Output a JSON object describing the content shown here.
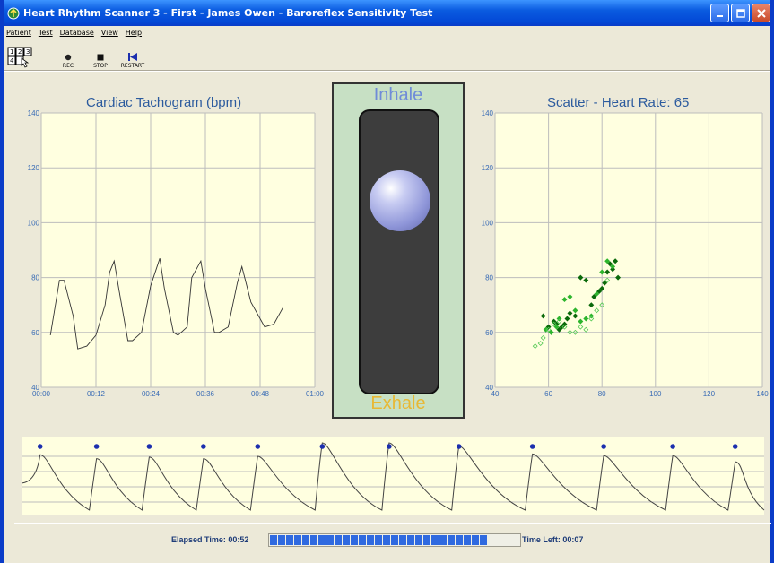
{
  "window": {
    "title": "Heart Rhythm Scanner 3 - First - James Owen - Baroreflex Sensitivity Test"
  },
  "menu": {
    "items": [
      "Patient",
      "Test",
      "Database",
      "View",
      "Help"
    ]
  },
  "toolbar": {
    "rec_label": "REC",
    "stop_label": "STOP",
    "restart_label": "RESTART"
  },
  "breathing": {
    "inhale": "Inhale",
    "exhale": "Exhale",
    "inhale_color": "#6F8BD8",
    "exhale_color": "#E8B834",
    "ball_level": 0.27
  },
  "status": {
    "elapsed": "Elapsed Time: 00:52",
    "left": "Time Left: 00:07",
    "progress_fraction": 0.88,
    "segment_color": "#2F6AE0"
  },
  "chart_data": [
    {
      "type": "line",
      "title": "Cardiac Tachogram (bpm)",
      "xlabel": "",
      "ylabel": "",
      "xlim": [
        0,
        60
      ],
      "ylim": [
        40,
        140
      ],
      "x_ticks": [
        "00:00",
        "00:12",
        "00:24",
        "00:36",
        "00:48",
        "01:00"
      ],
      "y_ticks": [
        "40",
        "60",
        "80",
        "100",
        "120",
        "140"
      ],
      "grid": true,
      "series": [
        {
          "color": "#333333",
          "x": [
            2,
            4,
            5,
            7,
            8,
            10,
            12,
            14,
            15,
            16,
            17,
            19,
            20,
            22,
            24,
            26,
            27,
            29,
            30,
            32,
            33,
            35,
            36,
            38,
            39,
            41,
            43,
            44,
            46,
            48,
            49,
            51,
            53
          ],
          "y": [
            59,
            79,
            79,
            66,
            54,
            55,
            59,
            70,
            82,
            86,
            76,
            57,
            57,
            60,
            77,
            87,
            76,
            60,
            59,
            62,
            80,
            86,
            76,
            60,
            60,
            62,
            78,
            84,
            71,
            65,
            62,
            63,
            69
          ]
        }
      ]
    },
    {
      "type": "scatter",
      "title": "Scatter - Heart Rate: 65",
      "xlim": [
        40,
        140
      ],
      "ylim": [
        40,
        140
      ],
      "x_ticks": [
        "40",
        "60",
        "80",
        "100",
        "120",
        "140"
      ],
      "y_ticks": [
        "40",
        "60",
        "80",
        "100",
        "120",
        "140"
      ],
      "grid": true,
      "series": [
        {
          "color": "#0B6A0B",
          "style": "filled",
          "x": [
            58,
            60,
            61,
            62,
            63,
            64,
            65,
            66,
            67,
            68,
            70,
            72,
            74,
            76,
            77,
            79,
            80,
            81,
            82,
            83,
            84,
            85,
            86
          ],
          "y": [
            66,
            62,
            60,
            64,
            63,
            61,
            62,
            63,
            65,
            67,
            66,
            80,
            79,
            70,
            73,
            75,
            76,
            78,
            82,
            85,
            83,
            86,
            80
          ]
        },
        {
          "color": "#2DB52D",
          "style": "filled",
          "x": [
            59,
            61,
            63,
            64,
            66,
            68,
            70,
            72,
            74,
            76,
            78,
            80,
            82,
            84
          ],
          "y": [
            61,
            60,
            62,
            65,
            72,
            73,
            68,
            64,
            65,
            66,
            74,
            82,
            86,
            84
          ]
        },
        {
          "color": "#55C955",
          "style": "hollow",
          "x": [
            55,
            57,
            58,
            60,
            62,
            64,
            66,
            68,
            70,
            72,
            74,
            76,
            78,
            80,
            82
          ],
          "y": [
            55,
            56,
            58,
            61,
            63,
            64,
            62,
            60,
            60,
            62,
            61,
            65,
            68,
            70,
            79
          ]
        }
      ]
    },
    {
      "type": "line",
      "title": "",
      "series": [
        {
          "color": "#444444",
          "beats": [
            0.025,
            0.101,
            0.172,
            0.245,
            0.318,
            0.405,
            0.495,
            0.589,
            0.688,
            0.784,
            0.877,
            0.961
          ],
          "beat_heights": [
            0.77,
            0.72,
            0.74,
            0.72,
            0.75,
            0.92,
            0.92,
            0.88,
            0.78,
            0.76,
            0.76,
            0.68
          ]
        }
      ],
      "marker_color": "#1C2FAE"
    }
  ]
}
